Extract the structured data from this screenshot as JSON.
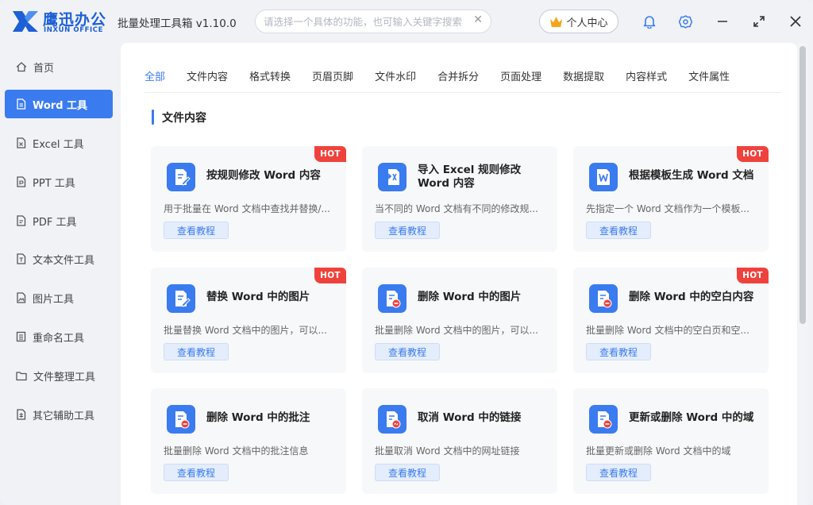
{
  "app": {
    "logo_cn": "鹰迅办公",
    "logo_en": "INXUN OFFICE",
    "title": "批量处理工具箱 v1.10.0",
    "search_placeholder": "请选择一个具体的功能，也可输入关键字搜索！",
    "user_center": "个人中心"
  },
  "colors": {
    "accent": "#3a7bef",
    "brand": "#1d5fd6",
    "hot": "#f0423c"
  },
  "sidebar": {
    "items": [
      {
        "label": "首页",
        "icon": "home-icon"
      },
      {
        "label": "Word 工具",
        "icon": "document-icon",
        "active": true
      },
      {
        "label": "Excel 工具",
        "icon": "document-icon"
      },
      {
        "label": "PPT 工具",
        "icon": "document-icon"
      },
      {
        "label": "PDF 工具",
        "icon": "document-icon"
      },
      {
        "label": "文本文件工具",
        "icon": "document-icon"
      },
      {
        "label": "图片工具",
        "icon": "image-icon"
      },
      {
        "label": "重命名工具",
        "icon": "rename-icon"
      },
      {
        "label": "文件整理工具",
        "icon": "folder-icon"
      },
      {
        "label": "其它辅助工具",
        "icon": "tools-icon"
      }
    ]
  },
  "tabs": [
    "全部",
    "文件内容",
    "格式转换",
    "页眉页脚",
    "文件水印",
    "合并拆分",
    "页面处理",
    "数据提取",
    "内容样式",
    "文件属性"
  ],
  "section": {
    "title": "文件内容"
  },
  "cards": [
    {
      "title": "按规则修改 Word 内容",
      "desc": "用于批量在 Word 文档中查找并替换/...",
      "button": "查看教程",
      "hot": "HOT",
      "icon": "edit-document-icon"
    },
    {
      "title": "导入 Excel 规则修改 Word 内容",
      "desc": "当不同的 Word 文档有不同的修改规...",
      "button": "查看教程",
      "hot": "",
      "icon": "import-excel-icon"
    },
    {
      "title": "根据模板生成 Word 文档",
      "desc": "先指定一个 Word 文档作为一个模板...",
      "button": "查看教程",
      "hot": "HOT",
      "icon": "word-template-icon"
    },
    {
      "title": "替换 Word 中的图片",
      "desc": "批量替换 Word 文档中的图片，可以...",
      "button": "查看教程",
      "hot": "HOT",
      "icon": "replace-image-icon"
    },
    {
      "title": "删除 Word 中的图片",
      "desc": "批量删除 Word 文档中的图片，可以...",
      "button": "查看教程",
      "hot": "",
      "icon": "delete-image-icon"
    },
    {
      "title": "删除 Word 中的空白内容",
      "desc": "批量删除 Word 文档中的空白页和空...",
      "button": "查看教程",
      "hot": "HOT",
      "icon": "delete-blank-icon"
    },
    {
      "title": "删除 Word 中的批注",
      "desc": "批量删除 Word 文档中的批注信息",
      "button": "查看教程",
      "hot": "",
      "icon": "delete-comment-icon"
    },
    {
      "title": "取消 Word 中的链接",
      "desc": "批量取消 Word 文档中的网址链接",
      "button": "查看教程",
      "hot": "",
      "icon": "unlink-icon"
    },
    {
      "title": "更新或删除 Word 中的域",
      "desc": "批量更新或删除 Word 文档中的域",
      "button": "查看教程",
      "hot": "",
      "icon": "field-icon"
    }
  ]
}
